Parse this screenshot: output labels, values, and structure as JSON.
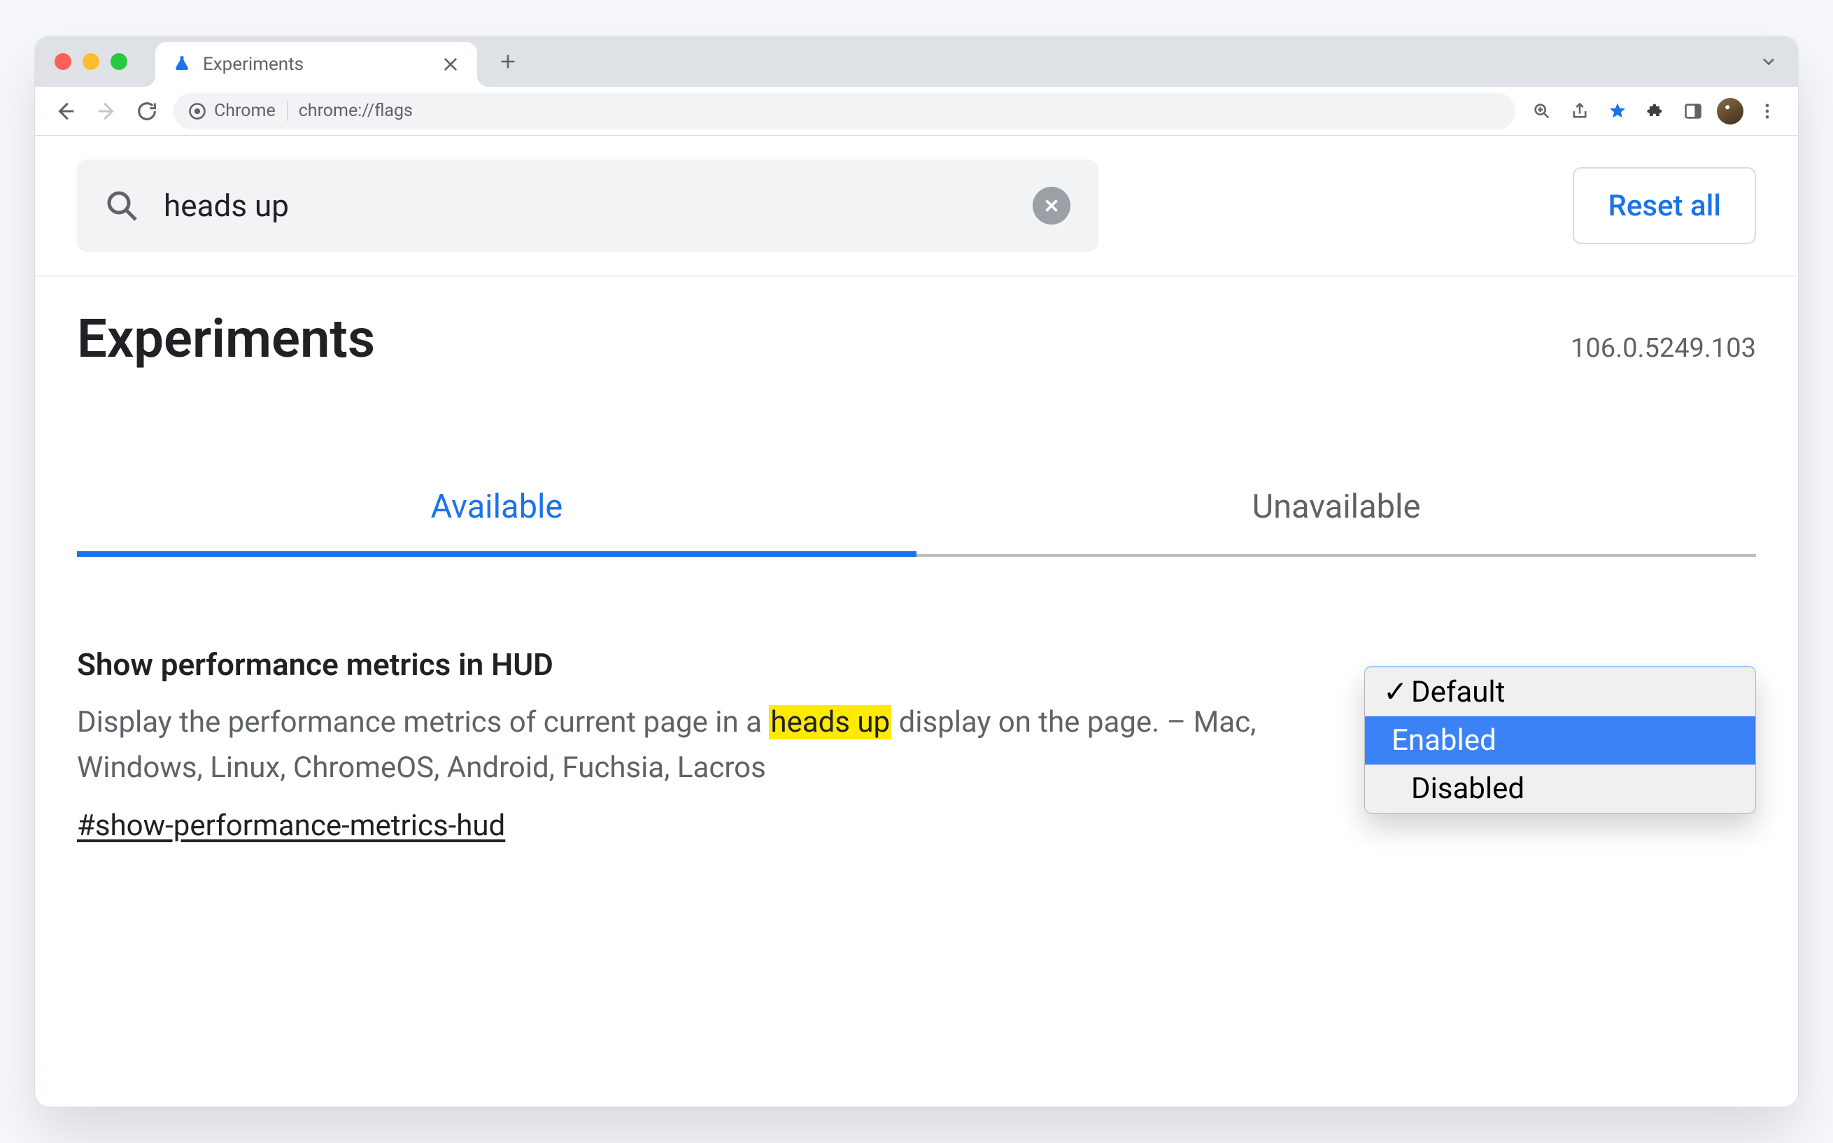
{
  "browser": {
    "tab_title": "Experiments",
    "omnibox_chip": "Chrome",
    "url": "chrome://flags"
  },
  "search": {
    "value": "heads up",
    "reset_label": "Reset all"
  },
  "header": {
    "title": "Experiments",
    "version": "106.0.5249.103"
  },
  "tabs": {
    "available": "Available",
    "unavailable": "Unavailable",
    "active": "available"
  },
  "flag": {
    "title": "Show performance metrics in HUD",
    "desc_before": "Display the performance metrics of current page in a ",
    "desc_highlight": "heads up",
    "desc_after": " display on the page. – Mac, Windows, Linux, ChromeOS, Android, Fuchsia, Lacros",
    "link": "#show-performance-metrics-hud",
    "dropdown": {
      "options": [
        "Default",
        "Enabled",
        "Disabled"
      ],
      "checked": "Default",
      "hovered": "Enabled"
    }
  }
}
